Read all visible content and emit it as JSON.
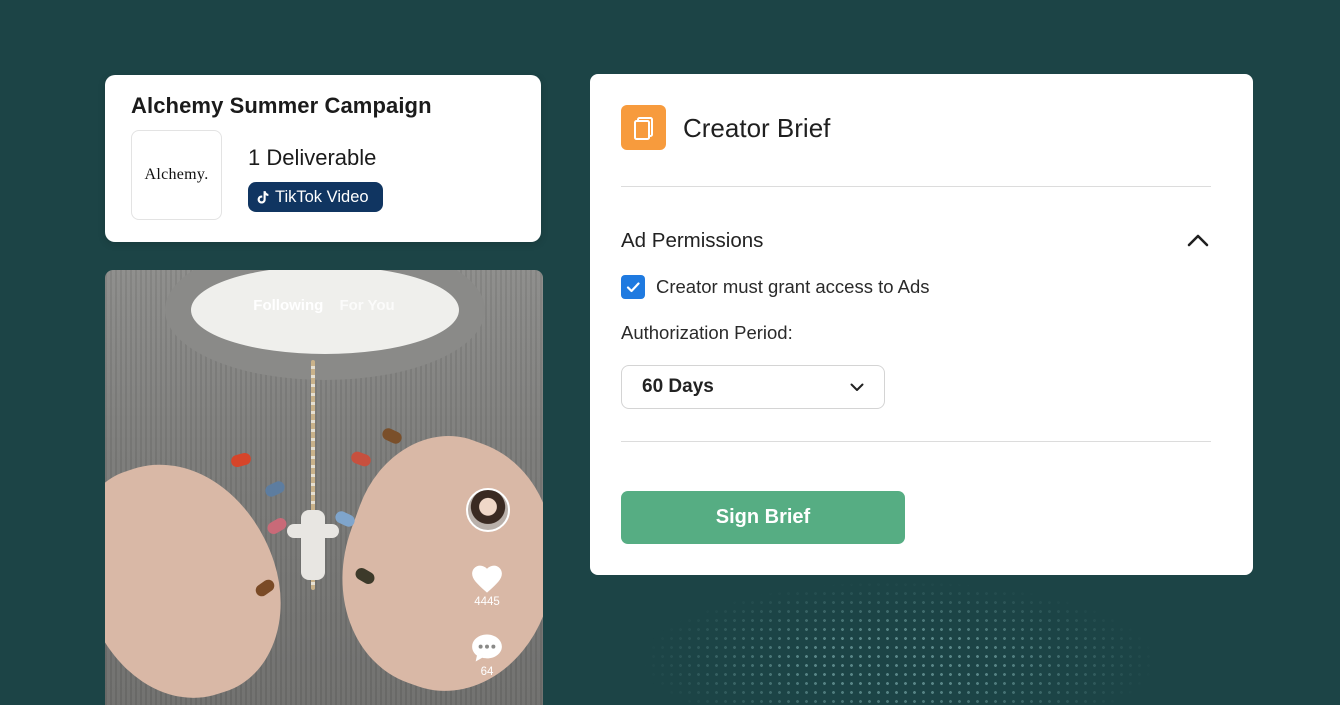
{
  "campaign": {
    "title": "Alchemy Summer Campaign",
    "brand_logo_text": "Alchemy.",
    "deliverables": "1 Deliverable",
    "deliverable_type": "TikTok Video"
  },
  "video": {
    "tabs": {
      "following": "Following",
      "for_you": "For You"
    },
    "likes": "4445",
    "comments": "64"
  },
  "brief": {
    "title": "Creator Brief",
    "icon": "document-icon",
    "section_title": "Ad Permissions",
    "checkbox_label": "Creator must grant access to Ads",
    "checkbox_checked": true,
    "period_label": "Authorization Period:",
    "period_value": "60 Days",
    "sign_button": "Sign Brief"
  },
  "colors": {
    "background": "#1c4446",
    "accent_orange": "#f79b3d",
    "checkbox_blue": "#1f7ae0",
    "button_green": "#56ad83",
    "tiktok_chip": "#103561"
  }
}
